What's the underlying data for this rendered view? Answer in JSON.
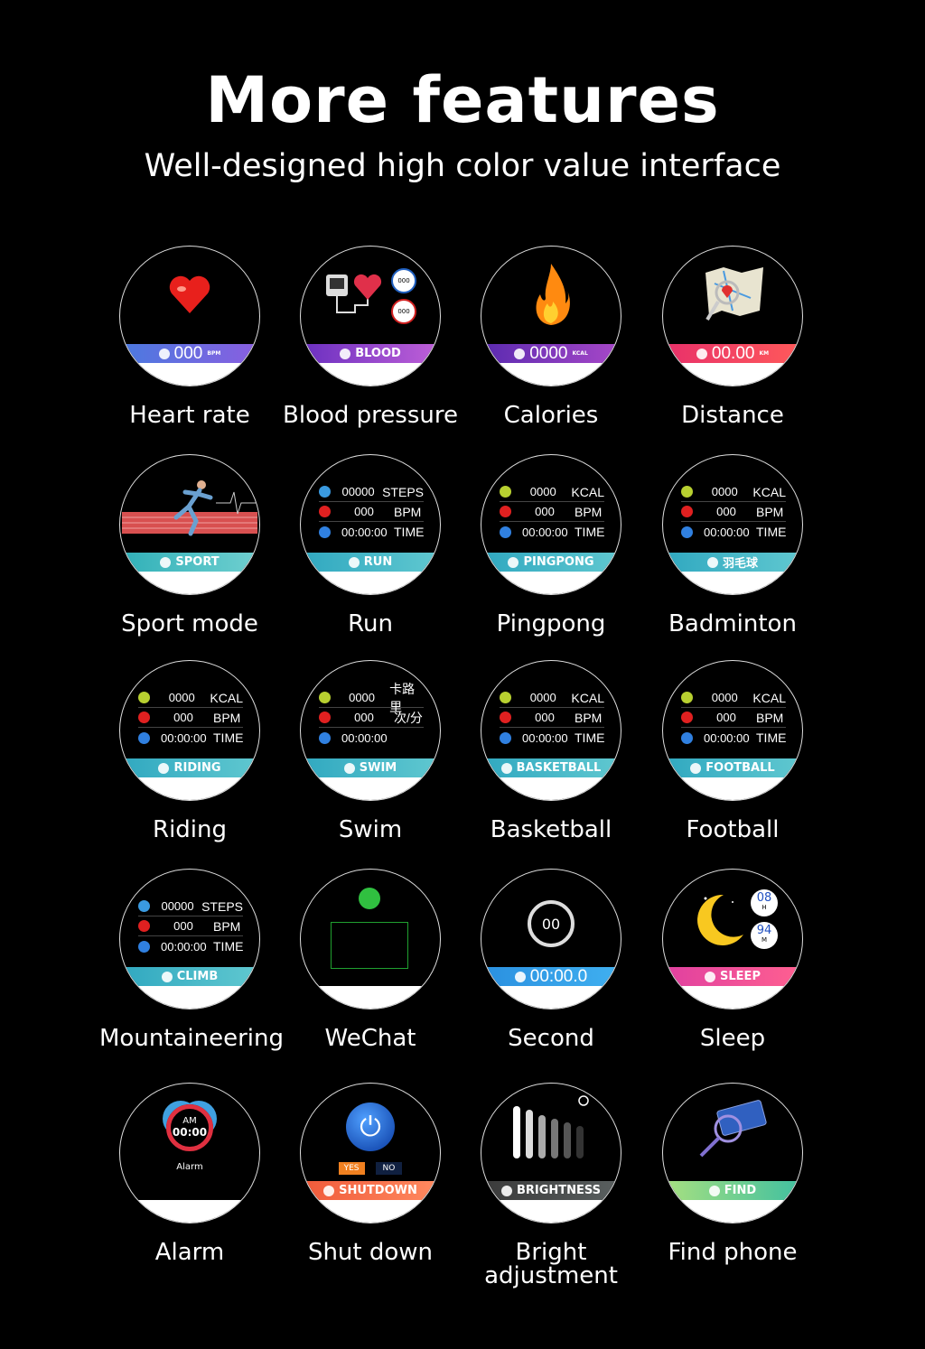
{
  "header": {
    "title": "More features",
    "subtitle": "Well-designed high color value interface"
  },
  "colors": {
    "kcal": "#b8d030",
    "heart": "#e02020",
    "clock": "#3080e0"
  },
  "features": [
    {
      "label": "Heart rate",
      "kind": "heart",
      "band": {
        "value": "000",
        "unit": "BPM",
        "colors": [
          "#4a7ae0",
          "#8a5ee0"
        ]
      }
    },
    {
      "label": "Blood pressure",
      "kind": "blood",
      "band": {
        "text": "BLOOD",
        "colors": [
          "#6a2fc0",
          "#c060d8"
        ]
      },
      "readings": [
        "000",
        "000"
      ]
    },
    {
      "label": "Calories",
      "kind": "fire",
      "band": {
        "value": "0000",
        "unit": "KCAL",
        "colors": [
          "#5a2ab0",
          "#a848c8"
        ]
      }
    },
    {
      "label": "Distance",
      "kind": "map",
      "band": {
        "value": "00.00",
        "unit": "KM",
        "colors": [
          "#e8306a",
          "#ff5a5a"
        ]
      }
    },
    {
      "label": "Sport mode",
      "kind": "sport",
      "band": {
        "text": "SPORT",
        "colors": [
          "#30b0b8",
          "#70d0d0"
        ]
      }
    },
    {
      "label": "Run",
      "kind": "stats",
      "rows": [
        [
          "00000",
          "STEPS"
        ],
        [
          "000",
          "BPM"
        ],
        [
          "00:00:00",
          "TIME"
        ]
      ],
      "band": {
        "text": "RUN",
        "colors": [
          "#30a8c0",
          "#60c8d0"
        ]
      }
    },
    {
      "label": "Pingpong",
      "kind": "stats",
      "rows": [
        [
          "0000",
          "KCAL"
        ],
        [
          "000",
          "BPM"
        ],
        [
          "00:00:00",
          "TIME"
        ]
      ],
      "band": {
        "text": "PINGPONG",
        "colors": [
          "#30a8c0",
          "#60c8d0"
        ]
      }
    },
    {
      "label": "Badminton",
      "kind": "stats",
      "rows": [
        [
          "0000",
          "KCAL"
        ],
        [
          "000",
          "BPM"
        ],
        [
          "00:00:00",
          "TIME"
        ]
      ],
      "band": {
        "text": "羽毛球",
        "colors": [
          "#30a8c0",
          "#60c8d0"
        ]
      }
    },
    {
      "label": "Riding",
      "kind": "stats",
      "rows": [
        [
          "0000",
          "KCAL"
        ],
        [
          "000",
          "BPM"
        ],
        [
          "00:00:00",
          "TIME"
        ]
      ],
      "band": {
        "text": "RIDING",
        "colors": [
          "#30a8c0",
          "#60c8d0"
        ]
      }
    },
    {
      "label": "Swim",
      "kind": "stats",
      "rows": [
        [
          "0000",
          "卡路里"
        ],
        [
          "000",
          "次/分"
        ],
        [
          "00:00:00",
          ""
        ]
      ],
      "band": {
        "text": "SWIM",
        "colors": [
          "#30a8c0",
          "#60c8d0"
        ]
      }
    },
    {
      "label": "Basketball",
      "kind": "stats",
      "rows": [
        [
          "0000",
          "KCAL"
        ],
        [
          "000",
          "BPM"
        ],
        [
          "00:00:00",
          "TIME"
        ]
      ],
      "band": {
        "text": "BASKETBALL",
        "colors": [
          "#30a8c0",
          "#60c8d0"
        ]
      }
    },
    {
      "label": "Football",
      "kind": "stats",
      "rows": [
        [
          "0000",
          "KCAL"
        ],
        [
          "000",
          "BPM"
        ],
        [
          "00:00:00",
          "TIME"
        ]
      ],
      "band": {
        "text": "FOOTBALL",
        "colors": [
          "#30a8c0",
          "#60c8d0"
        ]
      }
    },
    {
      "label": "Mountaineering",
      "kind": "stats",
      "rows": [
        [
          "00000",
          "STEPS"
        ],
        [
          "000",
          "BPM"
        ],
        [
          "00:00:00",
          "TIME"
        ]
      ],
      "band": {
        "text": "CLIMB",
        "colors": [
          "#30a8c0",
          "#60c8d0"
        ]
      }
    },
    {
      "label": "WeChat",
      "kind": "wechat",
      "band": {
        "text": "",
        "colors": [
          "#000",
          "#000"
        ]
      }
    },
    {
      "label": "Second",
      "kind": "stopwatch",
      "dial": "00",
      "band": {
        "value": "00:00.0",
        "colors": [
          "#2a90e0",
          "#40b0f0"
        ]
      }
    },
    {
      "label": "Sleep",
      "kind": "sleep",
      "badges": [
        [
          "08",
          "H"
        ],
        [
          "94",
          "M"
        ]
      ],
      "band": {
        "text": "SLEEP",
        "colors": [
          "#e040a0",
          "#ff6090"
        ]
      }
    },
    {
      "label": "Alarm",
      "kind": "alarm",
      "ampm": "AM",
      "time": "00:00",
      "caption": "Alarm",
      "band": {
        "text": "",
        "colors": [
          "#000",
          "#000"
        ]
      }
    },
    {
      "label": "Shut down",
      "kind": "power",
      "yes": "YES",
      "no": "NO",
      "band": {
        "text": "SHUTDOWN",
        "colors": [
          "#f05a3a",
          "#ff8a60"
        ]
      }
    },
    {
      "label": "Bright\nadjustment",
      "kind": "bright",
      "band": {
        "text": "BRIGHTNESS",
        "colors": [
          "#3a3a3a",
          "#5a6060"
        ]
      }
    },
    {
      "label": "Find phone",
      "kind": "find",
      "band": {
        "text": "FIND",
        "colors": [
          "#a8e080",
          "#40c0a0"
        ]
      }
    }
  ]
}
